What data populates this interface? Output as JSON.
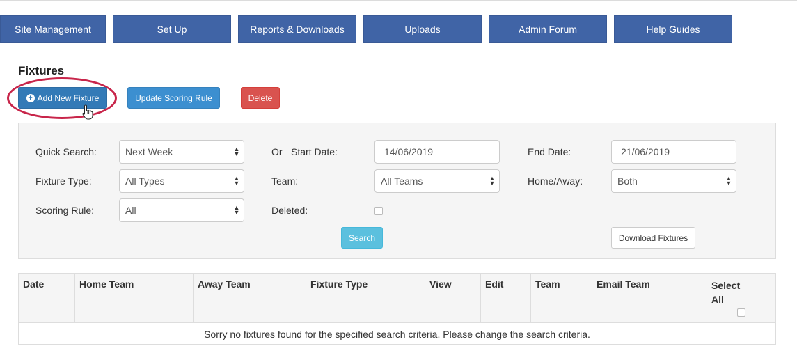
{
  "nav": {
    "items": [
      {
        "label": "Site Management"
      },
      {
        "label": "Set Up"
      },
      {
        "label": "Reports & Downloads"
      },
      {
        "label": "Uploads"
      },
      {
        "label": "Admin Forum"
      },
      {
        "label": "Help Guides"
      }
    ]
  },
  "page": {
    "title": "Fixtures"
  },
  "actions": {
    "add_label": "Add New Fixture",
    "update_scoring_label": "Update Scoring Rule",
    "delete_label": "Delete"
  },
  "search": {
    "quick_search_label": "Quick Search:",
    "quick_search_value": "Next Week",
    "or_label": "Or",
    "start_date_label": "Start Date:",
    "start_date_value": "14/06/2019",
    "end_date_label": "End Date:",
    "end_date_value": "21/06/2019",
    "fixture_type_label": "Fixture Type:",
    "fixture_type_value": "All Types",
    "team_label": "Team:",
    "team_value": "All Teams",
    "home_away_label": "Home/Away:",
    "home_away_value": "Both",
    "scoring_rule_label": "Scoring Rule:",
    "scoring_rule_value": "All",
    "deleted_label": "Deleted:",
    "deleted_checked": false,
    "search_button": "Search",
    "download_button": "Download Fixtures"
  },
  "table": {
    "columns": [
      "Date",
      "Home Team",
      "Away Team",
      "Fixture Type",
      "View",
      "Edit",
      "Team",
      "Email Team",
      "Select All"
    ],
    "empty_message": "Sorry no fixtures found for the specified search criteria. Please change the search criteria."
  },
  "colors": {
    "nav_bg": "#4064a6",
    "primary": "#337ab7",
    "danger": "#d9534f",
    "info": "#5bc0de",
    "highlight_ring": "#c8254a"
  },
  "icons": {
    "add": "plus-circle-icon",
    "cursor": "hand-pointer-icon",
    "select": "select-caret-icon"
  }
}
